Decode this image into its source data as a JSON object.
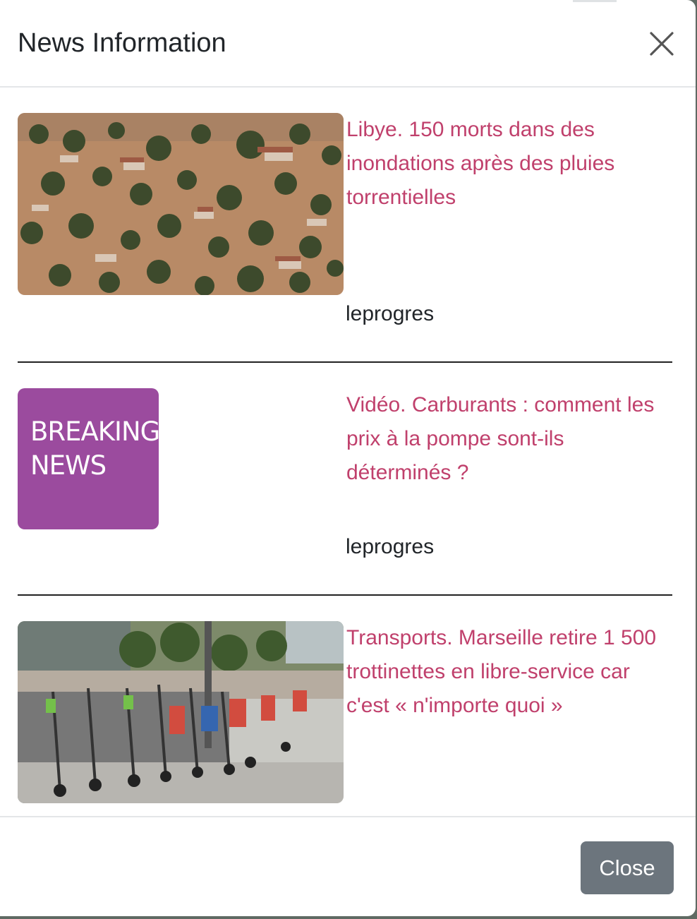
{
  "modal": {
    "title": "News Information",
    "close_icon": "close-icon",
    "footer": {
      "close_label": "Close"
    }
  },
  "news": [
    {
      "headline": "Libye. 150 morts dans des inondations après des pluies torrentielles",
      "source": "leprogres",
      "image": "flooded-town-aerial-photo"
    },
    {
      "headline": "Vidéo. Carburants : comment les prix à la pompe sont-ils déterminés ?",
      "source": "leprogres",
      "image": "breaking-news-placeholder",
      "image_text": [
        "BREAKING",
        "NEWS"
      ],
      "image_color": "#9b4b9e"
    },
    {
      "headline": "Transports. Marseille retire 1 500 trottinettes en libre-service car c'est « n'importe quoi »",
      "source": "",
      "image": "parked-scooters-photo"
    }
  ],
  "colors": {
    "headline": "#c0406c",
    "close_button": "#6c757d",
    "backdrop": "#5f6a63"
  }
}
